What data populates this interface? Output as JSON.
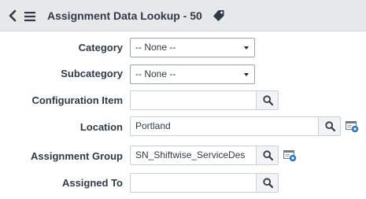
{
  "header": {
    "title": "Assignment Data Lookup - 50"
  },
  "form": {
    "category": {
      "label": "Category",
      "value": "-- None --"
    },
    "subcategory": {
      "label": "Subcategory",
      "value": "-- None --"
    },
    "configuration_item": {
      "label": "Configuration Item",
      "value": ""
    },
    "location": {
      "label": "Location",
      "value": "Portland"
    },
    "assignment_group": {
      "label": "Assignment Group",
      "value": "SN_Shiftwise_ServiceDes"
    },
    "assigned_to": {
      "label": "Assigned To",
      "value": ""
    }
  },
  "icons": {
    "back": "chevron-left-icon",
    "menu": "hamburger-menu-icon",
    "tag": "tag-icon",
    "search": "magnifier-icon",
    "reference": "reference-record-icon"
  },
  "colors": {
    "header_bg": "#e6e8ea",
    "text": "#303a46",
    "search_button_bg": "#f2f3f4",
    "reference_icon_blue": "#2e7bc1"
  }
}
